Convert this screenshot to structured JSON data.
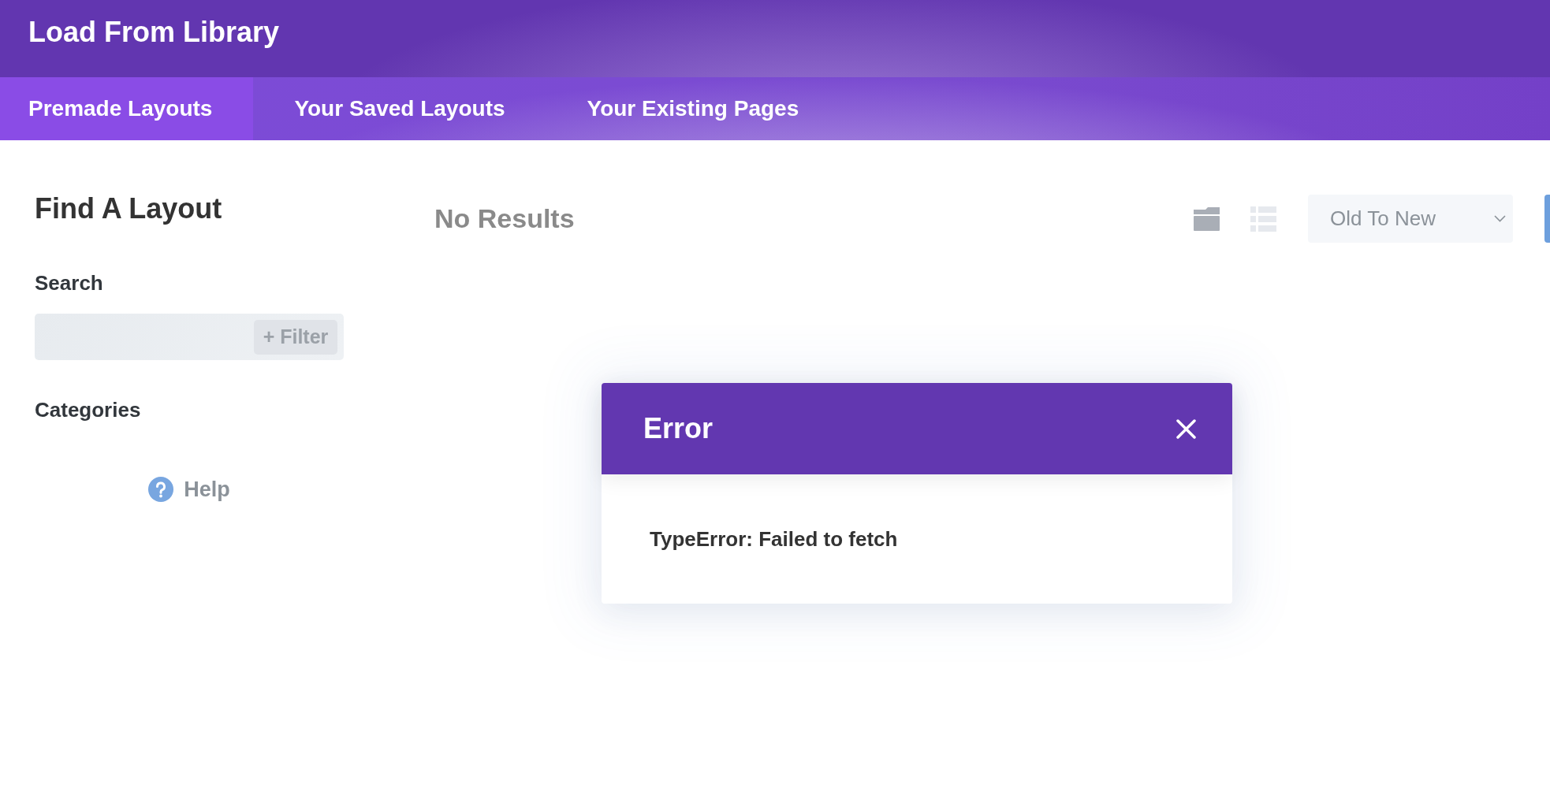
{
  "window": {
    "title": "Load From Library"
  },
  "tabs": [
    {
      "label": "Premade Layouts",
      "selected": true
    },
    {
      "label": "Your Saved Layouts",
      "selected": false
    },
    {
      "label": "Your Existing Pages",
      "selected": false
    }
  ],
  "sidebar": {
    "heading": "Find A Layout",
    "search_label": "Search",
    "filter_button": "+ Filter",
    "categories_label": "Categories",
    "help_link": "Help"
  },
  "results": {
    "heading": "No Results",
    "view_options": [
      {
        "kind": "folder",
        "selected": true
      },
      {
        "kind": "list",
        "selected": false
      }
    ],
    "sort": "Old To New"
  },
  "dialog": {
    "title": "Error",
    "message": "TypeError: Failed to fetch"
  }
}
